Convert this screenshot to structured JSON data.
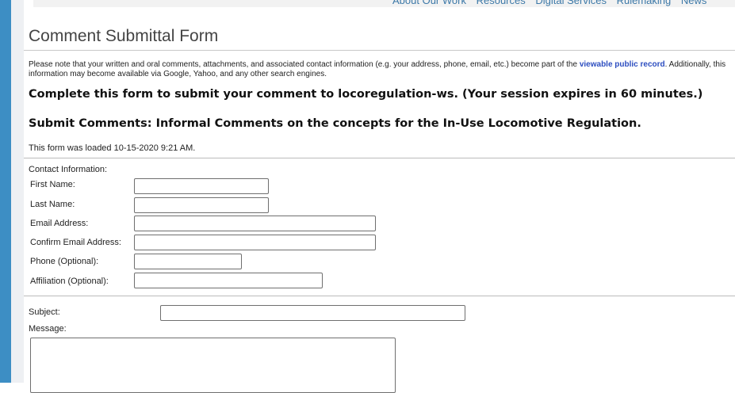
{
  "top_nav": [
    "About Our Work",
    "Resources",
    "Digital Services",
    "Rulemaking",
    "News"
  ],
  "page": {
    "title": "Comment Submittal Form",
    "notice_before": "Please note that your written and oral comments, attachments, and associated contact information (e.g. your address, phone, email, etc.) become part of the ",
    "notice_link": "viewable public record",
    "notice_after": ". Additionally, this information may become available via Google, Yahoo, and any other search engines.",
    "heading_complete": "Complete this form to submit your comment to locoregulation-ws. (Your session expires in 60 minutes.)",
    "heading_submit": "Submit Comments: Informal Comments on the concepts for the In-Use Locomotive Regulation.",
    "loaded_text": "This form was loaded 10-15-2020 9:21 AM."
  },
  "contact": {
    "section_label": "Contact Information:",
    "first_name": {
      "label": "First Name:",
      "value": ""
    },
    "last_name": {
      "label": "Last Name:",
      "value": ""
    },
    "email": {
      "label": "Email Address:",
      "value": ""
    },
    "confirm_email": {
      "label": "Confirm Email Address:",
      "value": ""
    },
    "phone": {
      "label": "Phone (Optional):",
      "value": ""
    },
    "affiliation": {
      "label": "Affiliation (Optional):",
      "value": ""
    }
  },
  "comment": {
    "subject": {
      "label": "Subject:",
      "value": ""
    },
    "message": {
      "label": "Message:",
      "value": ""
    }
  }
}
